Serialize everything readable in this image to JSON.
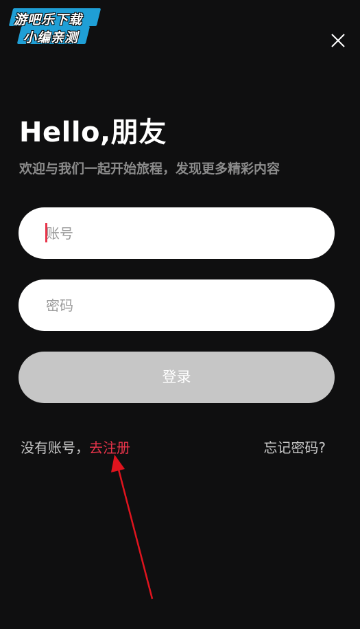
{
  "watermark": {
    "line1": "游吧乐下载",
    "line2": "小编亲测"
  },
  "header": {
    "close_icon": "close-icon"
  },
  "main": {
    "title": "Hello,朋友",
    "subtitle": "欢迎与我们一起开始旅程，发现更多精彩内容"
  },
  "form": {
    "account_placeholder": "账号",
    "password_placeholder": "密码",
    "login_label": "登录"
  },
  "footer": {
    "no_account_text": "没有账号，",
    "register_label": "去注册",
    "forgot_label": "忘记密码?"
  },
  "colors": {
    "background": "#0f0f10",
    "accent": "#e8344a",
    "button_disabled": "#c6c6c6",
    "annotation_arrow": "#e0141e"
  }
}
